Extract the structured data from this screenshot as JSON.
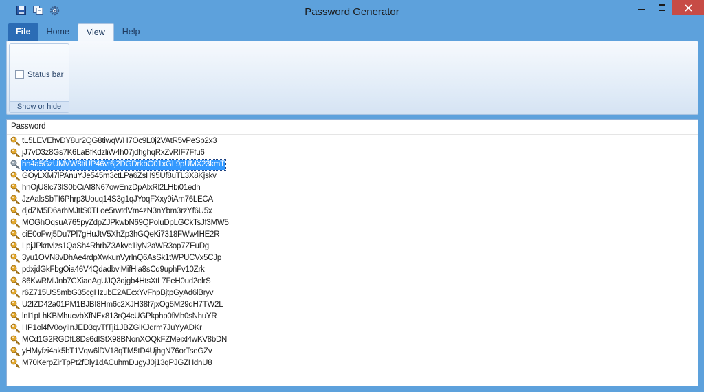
{
  "window": {
    "title": "Password Generator",
    "quick_access": [
      "save-icon",
      "copy-icon",
      "gear-icon"
    ],
    "controls": [
      "minimize-icon",
      "maximize-icon",
      "close-icon"
    ]
  },
  "ribbon": {
    "tabs": [
      {
        "label": "File",
        "state": "file"
      },
      {
        "label": "Home",
        "state": "normal"
      },
      {
        "label": "View",
        "state": "active"
      },
      {
        "label": "Help",
        "state": "normal"
      }
    ],
    "group": {
      "caption": "Show or hide",
      "checkbox_label": "Status bar",
      "checked": false
    }
  },
  "list": {
    "column_header": "Password",
    "selected_index": 2,
    "passwords": [
      "tL5LEVEhvDY8ur2QG8tiwqWH7Oc9L0j2VAtR5vPeSp2x3",
      "jJ7vD3z8Gs7K6LaBfKdzliW4h07jdhghqRxZvRIF7Ffu6",
      "hn4a5GzUMVW8tiUP46vt6j2DGDrkbO01xGL9pUMX23kmT",
      "GOyLXM7lPAnuYJe545m3ctLPa6ZsH95Uf8uTL3X8Kjskv",
      "hnOjU8lc73lS0bCiAf8N67owEnzDpAlxRl2LHbi01edh",
      "JzAalsSbTI6Phrp3Uouq14S3g1qJYoqFXxy9iAm76LECA",
      "djdZM5D6arhMJtIS0TLoe5rwtdVm4zN3nYbm3rzYf6U5x",
      "MOGhOqsuA765pyZdpZJPkwbN69QPoluDpLGCkTsJf3MW5",
      "ciE0oFwj5Du7Pl7gHuJtV5XhZp3hGQeKi7318FWw4HE2R",
      "LpjJPkrtvizs1QaSh4RhrbZ3Akvc1iyN2aWR3op7ZEuDg",
      "3yu1OVN8vDhAe4rdpXwkunVyrlnQ6AsSk1tWPUCVx5CJp",
      "pdxjdGkFbgOia46V4QdadbviMifHia8sCq9uphFv10Zrk",
      "86KwRMlJnb7CXiaeAgUJQ3djgb4HtsXtL7FeH0ud2elrS",
      "r6Z715US5mbG35cgHzubE2AEcxYvFhpBjtpGyAd6lBryv",
      "U2lZD42a01PM1BJBI8Hm6c2XJH38f7jxOg5M29dH7TW2L",
      "lnI1pLhKBMhucvbXfNEx813rQ4cUGPkphp0fMh0sNhuYR",
      "HP1ol4fV0oyiInJED3qvTfTji1JBZGlKJdrm7JuYyADKr",
      "MCd1G2RGDfL8Ds6dIStX98BNonXOQkFZMeixl4wKV8bDN",
      "yHMyfzi4ak5bT1Vqw6lDV18qTM5tD4UjhgN76orTseGZv",
      "M70KerpZirTpPt2fDly1dACuhmDugyJ0j13qPJGZHdnU8"
    ]
  },
  "colors": {
    "titlebar": "#5da1dc",
    "file_tab": "#2b6cb5",
    "selection": "#3399ff",
    "close_button": "#c74b45"
  }
}
